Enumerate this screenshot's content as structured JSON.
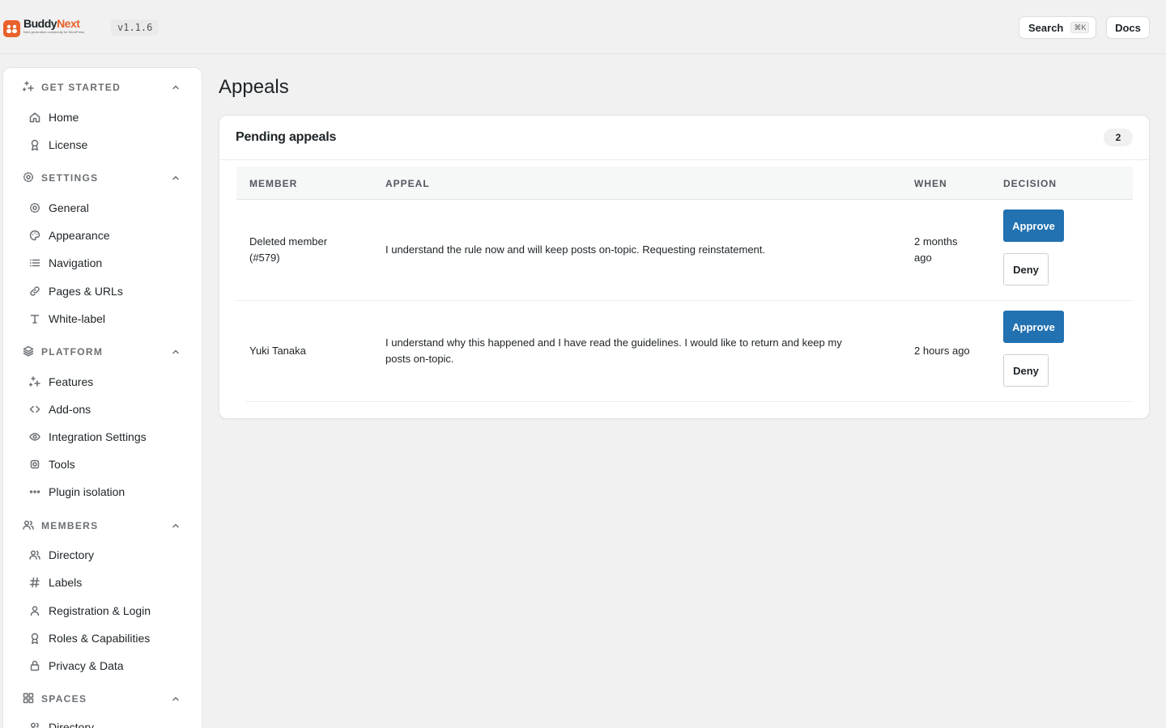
{
  "brand": {
    "name_a": "Buddy",
    "name_b": "Next",
    "tagline": "Next generation community for WordPress",
    "version": "v1.1.6"
  },
  "topbar": {
    "search_label": "Search",
    "search_shortcut": "⌘K",
    "docs_label": "Docs"
  },
  "sidebar": {
    "sections": [
      {
        "title": "GET STARTED",
        "items": [
          "Home",
          "License"
        ]
      },
      {
        "title": "SETTINGS",
        "items": [
          "General",
          "Appearance",
          "Navigation",
          "Pages & URLs",
          "White-label"
        ]
      },
      {
        "title": "PLATFORM",
        "items": [
          "Features",
          "Add-ons",
          "Integration Settings",
          "Tools",
          "Plugin isolation"
        ]
      },
      {
        "title": "MEMBERS",
        "items": [
          "Directory",
          "Labels",
          "Registration & Login",
          "Roles & Capabilities",
          "Privacy & Data"
        ]
      },
      {
        "title": "SPACES",
        "items": [
          "Directory"
        ]
      }
    ]
  },
  "page": {
    "title": "Appeals",
    "card_title": "Pending appeals",
    "count": "2",
    "columns": [
      "MEMBER",
      "APPEAL",
      "WHEN",
      "DECISION"
    ],
    "rows": [
      {
        "member_line1": "Deleted member",
        "member_line2": "(#579)",
        "appeal": "I understand the rule now and will keep posts on-topic. Requesting reinstatement.",
        "when_line1": "2 months",
        "when_line2": "ago",
        "approve": "Approve",
        "deny": "Deny"
      },
      {
        "member": "Yuki Tanaka",
        "appeal_line1": "I understand why this happened and I have read the guidelines. I would like to return and keep my",
        "appeal_line2": "posts on-topic.",
        "when": "2 hours ago",
        "approve": "Approve",
        "deny": "Deny"
      }
    ]
  },
  "colors": {
    "accent": "#2271b1",
    "brand": "#e8612c"
  },
  "icons": {
    "get_started": "sparkles-icon",
    "settings": "gear-icon",
    "platform": "layers-icon",
    "members": "users-icon",
    "spaces": "grid-icon"
  }
}
